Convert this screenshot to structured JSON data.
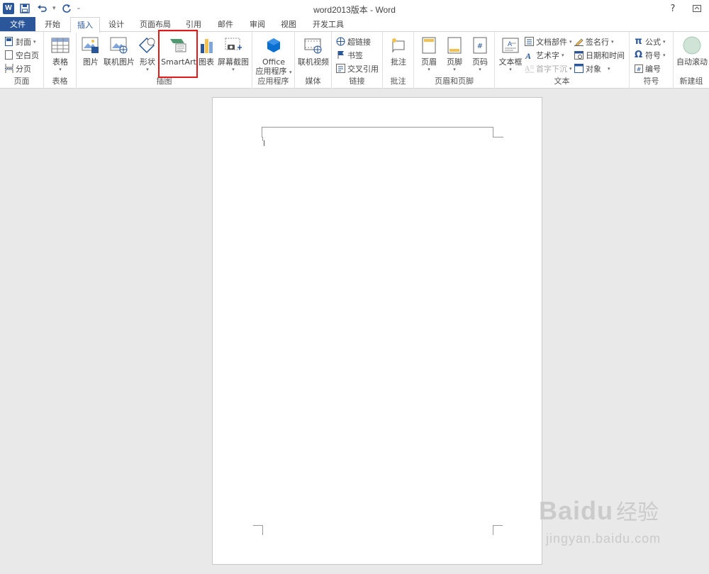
{
  "app": {
    "title": "word2013版本 - Word",
    "logo_letter": "W",
    "help": "?"
  },
  "tabs": [
    {
      "label": "文件"
    },
    {
      "label": "开始"
    },
    {
      "label": "插入"
    },
    {
      "label": "设计"
    },
    {
      "label": "页面布局"
    },
    {
      "label": "引用"
    },
    {
      "label": "邮件"
    },
    {
      "label": "审阅"
    },
    {
      "label": "视图"
    },
    {
      "label": "开发工具"
    }
  ],
  "active_tab": "插入",
  "ribbon": {
    "pages": {
      "group_label": "页面",
      "cover": "封面",
      "blank": "空白页",
      "page_break": "分页"
    },
    "tables": {
      "group_label": "表格",
      "table": "表格"
    },
    "illustrations": {
      "group_label": "插图",
      "pictures": "图片",
      "online_pictures": "联机图片",
      "shapes": "形状",
      "smartart": "SmartArt",
      "chart": "图表",
      "screenshot": "屏幕截图"
    },
    "apps": {
      "group_label": "应用程序",
      "office_line1": "Office",
      "office_line2": "应用程序"
    },
    "media": {
      "group_label": "媒体",
      "online_video": "联机视频"
    },
    "links": {
      "group_label": "链接",
      "hyperlink": "超链接",
      "bookmark": "书签",
      "cross_ref": "交叉引用"
    },
    "comments": {
      "group_label": "批注",
      "comment": "批注"
    },
    "header_footer": {
      "group_label": "页眉和页脚",
      "header": "页眉",
      "footer": "页脚",
      "page_number": "页码"
    },
    "text": {
      "group_label": "文本",
      "textbox": "文本框",
      "quick_parts": "文档部件",
      "wordart": "艺术字",
      "drop_cap": "首字下沉",
      "signature": "签名行",
      "datetime": "日期和时间",
      "object": "对象"
    },
    "symbols": {
      "group_label": "符号",
      "equation": "公式",
      "symbol": "符号",
      "number": "编号"
    },
    "new_group": {
      "group_label": "新建组",
      "autoscroll": "自动滚动"
    }
  },
  "watermark": {
    "brand": "Baidu",
    "cn": "经验",
    "url": "jingyan.baidu.com"
  },
  "colors": {
    "accent": "#2b579a",
    "highlight": "#e01919"
  }
}
